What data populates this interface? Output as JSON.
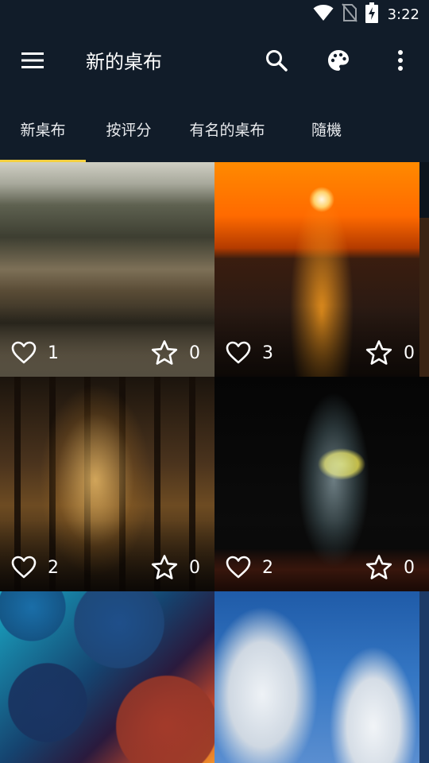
{
  "status_bar": {
    "time": "3:22",
    "icons": [
      "wifi-icon",
      "no-sim-icon",
      "battery-charging-icon"
    ]
  },
  "app_bar": {
    "title": "新的桌布",
    "actions": [
      "search-icon",
      "palette-icon",
      "more-vert-icon"
    ]
  },
  "tabs": [
    {
      "label": "新桌布",
      "selected": true
    },
    {
      "label": "按评分",
      "selected": false
    },
    {
      "label": "有名的桌布",
      "selected": false
    },
    {
      "label": "隨機",
      "selected": false
    }
  ],
  "colors": {
    "background": "#111c29",
    "tab_indicator": "#f4d03f",
    "text": "#ffffff"
  },
  "wallpapers": [
    {
      "subject": "child on bench by lake",
      "likes": "1",
      "favorites": "0"
    },
    {
      "subject": "sunset over water",
      "likes": "3",
      "favorites": "0"
    },
    {
      "subject": "sunlit forest",
      "likes": "2",
      "favorites": "0"
    },
    {
      "subject": "splashing water glass with lemon",
      "likes": "2",
      "favorites": "0"
    },
    {
      "subject": "abstract colorful circles",
      "likes": "",
      "favorites": ""
    },
    {
      "subject": "snowy trees under blue sky",
      "likes": "",
      "favorites": ""
    }
  ]
}
